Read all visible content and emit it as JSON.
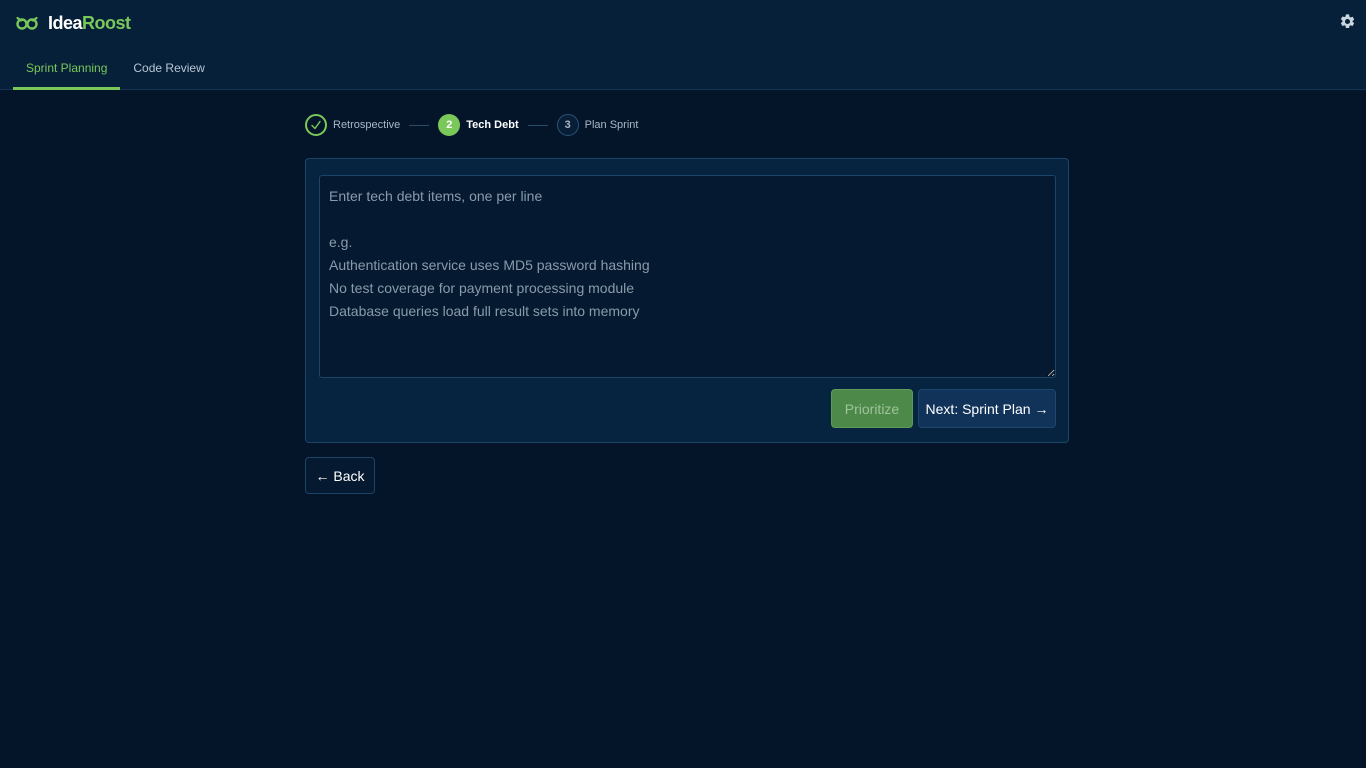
{
  "app": {
    "name_part1": "Idea",
    "name_part2": "Roost",
    "accent_color": "#7ac75a"
  },
  "icons": {
    "logo": "owl-eyes-logo-icon",
    "settings": "gear-icon",
    "step_done": "checkmark-icon"
  },
  "tabs": [
    {
      "label": "Sprint Planning",
      "active": true
    },
    {
      "label": "Code Review",
      "active": false
    }
  ],
  "stepper": {
    "steps": [
      {
        "number": "✓",
        "label": "Retrospective",
        "state": "done"
      },
      {
        "number": "2",
        "label": "Tech Debt",
        "state": "active"
      },
      {
        "number": "3",
        "label": "Plan Sprint",
        "state": "pending"
      }
    ]
  },
  "editor": {
    "value": "",
    "placeholder": "Enter tech debt items, one per line\n\ne.g.\nAuthentication service uses MD5 password hashing\nNo test coverage for payment processing module\nDatabase queries load full result sets into memory"
  },
  "actions": {
    "prioritize_label": "Prioritize",
    "next_label": "Next: Sprint Plan →",
    "back_label": "← Back"
  }
}
